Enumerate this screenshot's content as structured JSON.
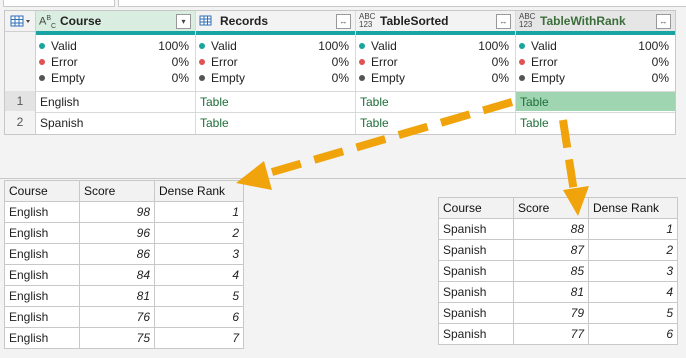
{
  "query_grid": {
    "columns": [
      {
        "name": "Course",
        "type_icon": "text-type-icon",
        "quality": {
          "valid": "100%",
          "error": "0%",
          "empty": "0%"
        }
      },
      {
        "name": "Records",
        "type_icon": "table-type-icon",
        "quality": {
          "valid": "100%",
          "error": "0%",
          "empty": "0%"
        }
      },
      {
        "name": "TableSorted",
        "type_icon": "any-type-icon",
        "quality": {
          "valid": "100%",
          "error": "0%",
          "empty": "0%"
        }
      },
      {
        "name": "TableWithRank",
        "type_icon": "any-type-icon",
        "quality": {
          "valid": "100%",
          "error": "0%",
          "empty": "0%"
        }
      }
    ],
    "quality_labels": {
      "valid": "Valid",
      "error": "Error",
      "empty": "Empty"
    },
    "quality_colors": {
      "valid": "#1aa39a",
      "error": "#e05050",
      "empty": "#555555"
    },
    "rows": [
      {
        "num": "1",
        "course": "English",
        "records": "Table",
        "sorted": "Table",
        "ranked": "Table"
      },
      {
        "num": "2",
        "course": "Spanish",
        "records": "Table",
        "sorted": "Table",
        "ranked": "Table"
      }
    ]
  },
  "left_table": {
    "headers": [
      "Course",
      "Score",
      "Dense Rank"
    ],
    "rows": [
      [
        "English",
        "98",
        "1"
      ],
      [
        "English",
        "96",
        "2"
      ],
      [
        "English",
        "86",
        "3"
      ],
      [
        "English",
        "84",
        "4"
      ],
      [
        "English",
        "81",
        "5"
      ],
      [
        "English",
        "76",
        "6"
      ],
      [
        "English",
        "75",
        "7"
      ]
    ]
  },
  "right_table": {
    "headers": [
      "Course",
      "Score",
      "Dense Rank"
    ],
    "rows": [
      [
        "Spanish",
        "88",
        "1"
      ],
      [
        "Spanish",
        "87",
        "2"
      ],
      [
        "Spanish",
        "85",
        "3"
      ],
      [
        "Spanish",
        "81",
        "4"
      ],
      [
        "Spanish",
        "79",
        "5"
      ],
      [
        "Spanish",
        "77",
        "6"
      ]
    ]
  },
  "colors": {
    "accent": "#1aa3a3",
    "arrow": "#f0a30a",
    "selected_cell": "#9fd5b1",
    "table_link": "#1e6e3a"
  }
}
